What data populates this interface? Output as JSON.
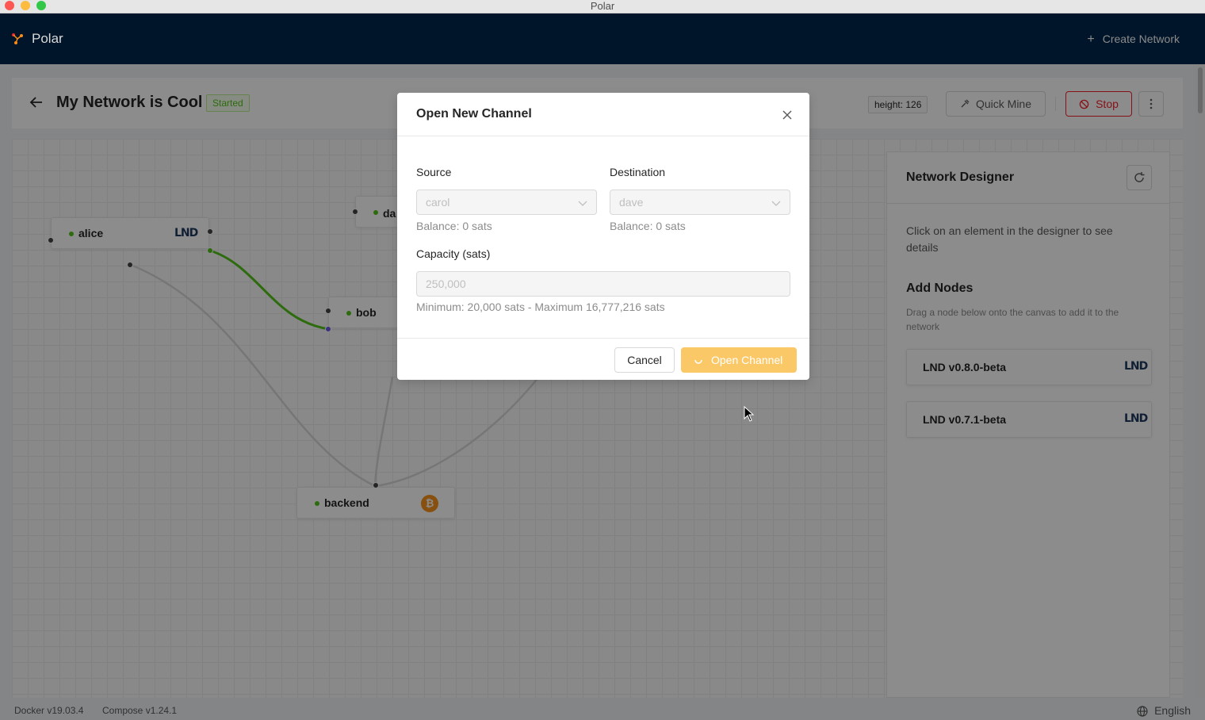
{
  "window": {
    "title": "Polar"
  },
  "header": {
    "app_name": "Polar",
    "create_network_label": "Create Network"
  },
  "network": {
    "title": "My Network is Cool",
    "status": "Started",
    "height": "height: 126",
    "quick_mine_label": "Quick Mine",
    "stop_label": "Stop"
  },
  "canvas": {
    "nodes": [
      {
        "name": "alice",
        "type": "LND"
      },
      {
        "name": "bob",
        "type": "LND"
      },
      {
        "name": "da",
        "type": "LND"
      },
      {
        "name": "backend",
        "type": "bitcoind"
      }
    ],
    "lnd_logo_text": "LND",
    "btc_logo_text": "₿"
  },
  "sidebar": {
    "title": "Network Designer",
    "info": "Click on an element in the designer to see details",
    "add_nodes_title": "Add Nodes",
    "add_nodes_hint": "Drag a node below onto the canvas to add it to the network",
    "node_types": [
      "LND v0.8.0-beta",
      "LND v0.7.1-beta"
    ]
  },
  "modal": {
    "title": "Open New Channel",
    "source_label": "Source",
    "source_value": "carol",
    "source_balance": "Balance: 0 sats",
    "destination_label": "Destination",
    "destination_value": "dave",
    "destination_balance": "Balance: 0 sats",
    "capacity_label": "Capacity (sats)",
    "capacity_value": "250,000",
    "capacity_help": "Minimum: 20,000 sats - Maximum 16,777,216 sats",
    "cancel_label": "Cancel",
    "open_label": "Open Channel"
  },
  "footer": {
    "docker": "Docker v19.03.4",
    "compose": "Compose v1.24.1",
    "language": "English"
  },
  "colors": {
    "header_bg": "#001529",
    "accent_orange": "#fbc868",
    "status_green": "#52c41a",
    "stop_red": "#f5222d"
  }
}
